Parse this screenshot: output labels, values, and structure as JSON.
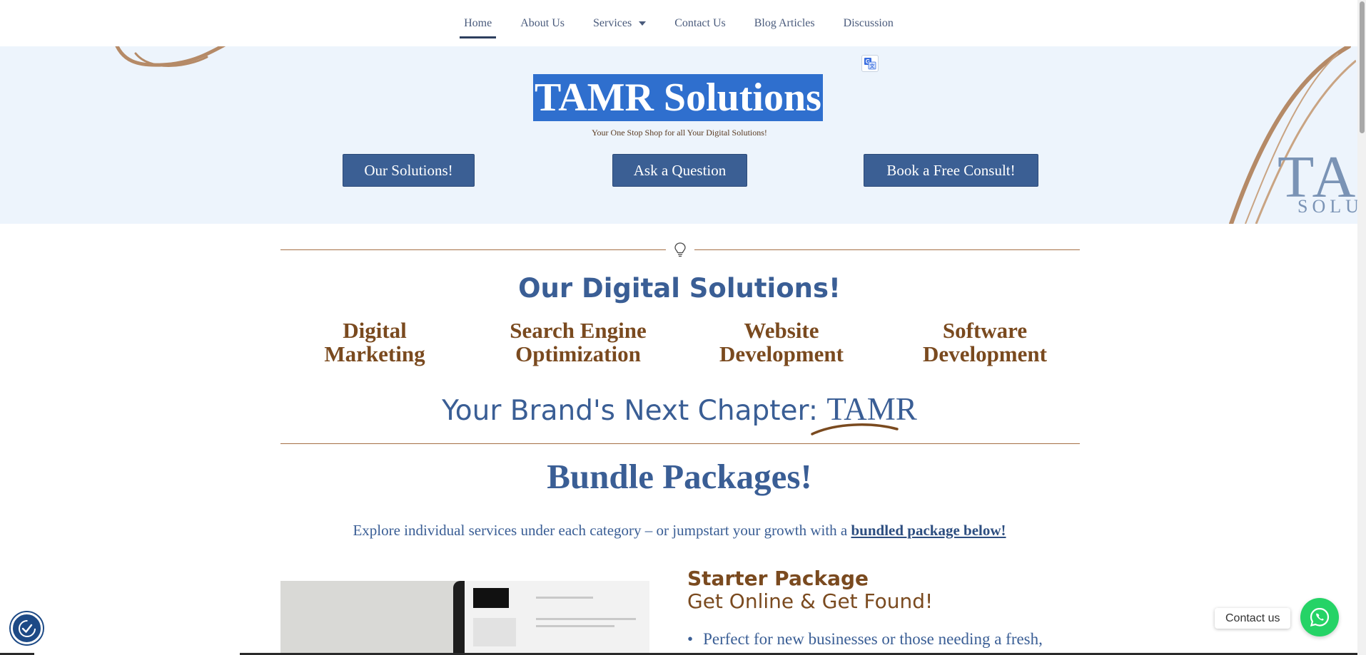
{
  "nav": {
    "items": [
      {
        "label": "Home"
      },
      {
        "label": "About Us"
      },
      {
        "label": "Services"
      },
      {
        "label": "Contact Us"
      },
      {
        "label": "Blog Articles"
      },
      {
        "label": "Discussion"
      }
    ]
  },
  "hero": {
    "title": "TAMR Solutions",
    "subtitle": "Your One Stop Shop for all Your Digital Solutions!",
    "buttons": {
      "solutions": "Our Solutions!",
      "question": "Ask a Question",
      "consult": "Book a Free Consult!"
    },
    "deco_word": "TA",
    "deco_sub": "SOLU"
  },
  "solutions": {
    "heading": "Our Digital Solutions!",
    "items": [
      {
        "line1": "Digital",
        "line2": "Marketing"
      },
      {
        "line1": "Search Engine",
        "line2": "Optimization"
      },
      {
        "line1": "Website",
        "line2": "Development"
      },
      {
        "line1": "Software",
        "line2": "Development"
      }
    ]
  },
  "brand": {
    "prefix": "Your Brand's Next Chapter: ",
    "name": "TAMR"
  },
  "bundles": {
    "heading": "Bundle Packages!",
    "intro": "Explore individual services under each category – or jumpstart your growth with a ",
    "intro_link": "bundled package below!"
  },
  "package": {
    "name": "Starter Package",
    "tagline": "Get Online & Get Found!",
    "bullet": "Perfect for new businesses or those needing a fresh,"
  },
  "floating": {
    "contact_label": "Contact us"
  },
  "colors": {
    "primary_blue": "#3b5f94",
    "brown_accent": "#7a4a1f",
    "hero_bg": "#edf4fc",
    "whatsapp_green": "#25d366"
  }
}
